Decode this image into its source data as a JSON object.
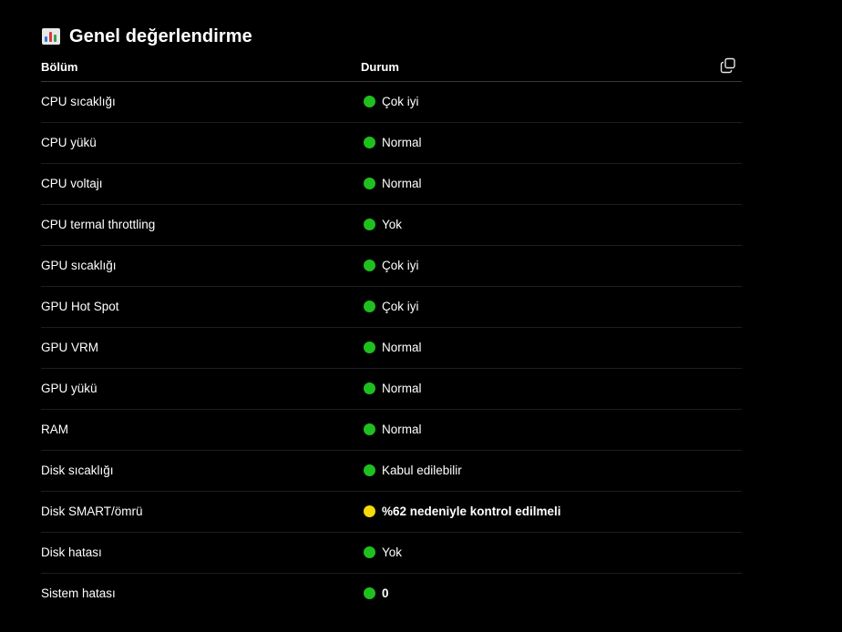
{
  "heading": {
    "icon": "bar-chart-icon",
    "title": "Genel değerlendirme"
  },
  "table": {
    "columns": [
      "Bölüm",
      "Durum"
    ],
    "copy_icon": "copy-icon",
    "rows": [
      {
        "section": "CPU sıcaklığı",
        "status": "Çok iyi",
        "color": "#1fbf1f",
        "bold": false
      },
      {
        "section": "CPU yükü",
        "status": "Normal",
        "color": "#1fbf1f",
        "bold": false
      },
      {
        "section": "CPU voltajı",
        "status": "Normal",
        "color": "#1fbf1f",
        "bold": false
      },
      {
        "section": "CPU termal throttling",
        "status": "Yok",
        "color": "#1fbf1f",
        "bold": false
      },
      {
        "section": "GPU sıcaklığı",
        "status": "Çok iyi",
        "color": "#1fbf1f",
        "bold": false
      },
      {
        "section": "GPU Hot Spot",
        "status": "Çok iyi",
        "color": "#1fbf1f",
        "bold": false
      },
      {
        "section": "GPU VRM",
        "status": "Normal",
        "color": "#1fbf1f",
        "bold": false
      },
      {
        "section": "GPU yükü",
        "status": "Normal",
        "color": "#1fbf1f",
        "bold": false
      },
      {
        "section": "RAM",
        "status": "Normal",
        "color": "#1fbf1f",
        "bold": false
      },
      {
        "section": "Disk sıcaklığı",
        "status": "Kabul edilebilir",
        "color": "#1fbf1f",
        "bold": false
      },
      {
        "section": "Disk SMART/ömrü",
        "status": "%62 nedeniyle kontrol edilmeli",
        "color": "#f5d90a",
        "bold": true
      },
      {
        "section": "Disk hatası",
        "status": "Yok",
        "color": "#1fbf1f",
        "bold": false
      },
      {
        "section": "Sistem hatası",
        "status": "0",
        "color": "#1fbf1f",
        "bold": true
      }
    ]
  }
}
